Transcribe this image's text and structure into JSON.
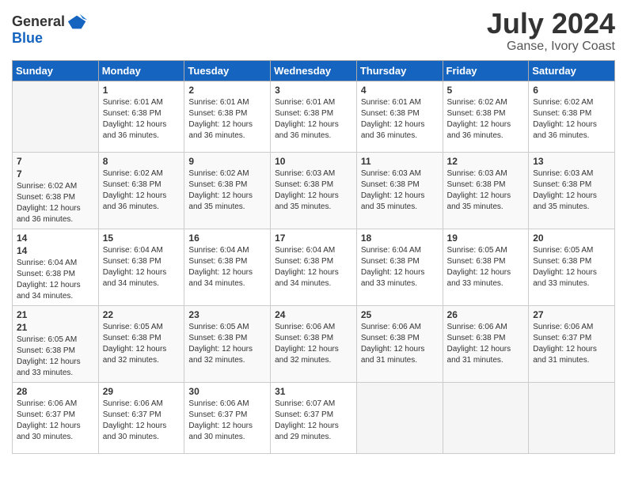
{
  "logo": {
    "line1": "General",
    "line2": "Blue"
  },
  "title": "July 2024",
  "location": "Ganse, Ivory Coast",
  "days_of_week": [
    "Sunday",
    "Monday",
    "Tuesday",
    "Wednesday",
    "Thursday",
    "Friday",
    "Saturday"
  ],
  "weeks": [
    [
      {
        "day": "",
        "info": ""
      },
      {
        "day": "1",
        "info": "Sunrise: 6:01 AM\nSunset: 6:38 PM\nDaylight: 12 hours and 36 minutes."
      },
      {
        "day": "2",
        "info": "Sunrise: 6:01 AM\nSunset: 6:38 PM\nDaylight: 12 hours and 36 minutes."
      },
      {
        "day": "3",
        "info": "Sunrise: 6:01 AM\nSunset: 6:38 PM\nDaylight: 12 hours and 36 minutes."
      },
      {
        "day": "4",
        "info": "Sunrise: 6:01 AM\nSunset: 6:38 PM\nDaylight: 12 hours and 36 minutes."
      },
      {
        "day": "5",
        "info": "Sunrise: 6:02 AM\nSunset: 6:38 PM\nDaylight: 12 hours and 36 minutes."
      },
      {
        "day": "6",
        "info": "Sunrise: 6:02 AM\nSunset: 6:38 PM\nDaylight: 12 hours and 36 minutes."
      }
    ],
    [
      {
        "day": "7",
        "info": ""
      },
      {
        "day": "8",
        "info": "Sunrise: 6:02 AM\nSunset: 6:38 PM\nDaylight: 12 hours and 36 minutes."
      },
      {
        "day": "9",
        "info": "Sunrise: 6:02 AM\nSunset: 6:38 PM\nDaylight: 12 hours and 35 minutes."
      },
      {
        "day": "10",
        "info": "Sunrise: 6:03 AM\nSunset: 6:38 PM\nDaylight: 12 hours and 35 minutes."
      },
      {
        "day": "11",
        "info": "Sunrise: 6:03 AM\nSunset: 6:38 PM\nDaylight: 12 hours and 35 minutes."
      },
      {
        "day": "12",
        "info": "Sunrise: 6:03 AM\nSunset: 6:38 PM\nDaylight: 12 hours and 35 minutes."
      },
      {
        "day": "13",
        "info": "Sunrise: 6:03 AM\nSunset: 6:38 PM\nDaylight: 12 hours and 35 minutes."
      }
    ],
    [
      {
        "day": "14",
        "info": ""
      },
      {
        "day": "15",
        "info": "Sunrise: 6:04 AM\nSunset: 6:38 PM\nDaylight: 12 hours and 34 minutes."
      },
      {
        "day": "16",
        "info": "Sunrise: 6:04 AM\nSunset: 6:38 PM\nDaylight: 12 hours and 34 minutes."
      },
      {
        "day": "17",
        "info": "Sunrise: 6:04 AM\nSunset: 6:38 PM\nDaylight: 12 hours and 34 minutes."
      },
      {
        "day": "18",
        "info": "Sunrise: 6:04 AM\nSunset: 6:38 PM\nDaylight: 12 hours and 33 minutes."
      },
      {
        "day": "19",
        "info": "Sunrise: 6:05 AM\nSunset: 6:38 PM\nDaylight: 12 hours and 33 minutes."
      },
      {
        "day": "20",
        "info": "Sunrise: 6:05 AM\nSunset: 6:38 PM\nDaylight: 12 hours and 33 minutes."
      }
    ],
    [
      {
        "day": "21",
        "info": ""
      },
      {
        "day": "22",
        "info": "Sunrise: 6:05 AM\nSunset: 6:38 PM\nDaylight: 12 hours and 32 minutes."
      },
      {
        "day": "23",
        "info": "Sunrise: 6:05 AM\nSunset: 6:38 PM\nDaylight: 12 hours and 32 minutes."
      },
      {
        "day": "24",
        "info": "Sunrise: 6:06 AM\nSunset: 6:38 PM\nDaylight: 12 hours and 32 minutes."
      },
      {
        "day": "25",
        "info": "Sunrise: 6:06 AM\nSunset: 6:38 PM\nDaylight: 12 hours and 31 minutes."
      },
      {
        "day": "26",
        "info": "Sunrise: 6:06 AM\nSunset: 6:38 PM\nDaylight: 12 hours and 31 minutes."
      },
      {
        "day": "27",
        "info": "Sunrise: 6:06 AM\nSunset: 6:37 PM\nDaylight: 12 hours and 31 minutes."
      }
    ],
    [
      {
        "day": "28",
        "info": "Sunrise: 6:06 AM\nSunset: 6:37 PM\nDaylight: 12 hours and 30 minutes."
      },
      {
        "day": "29",
        "info": "Sunrise: 6:06 AM\nSunset: 6:37 PM\nDaylight: 12 hours and 30 minutes."
      },
      {
        "day": "30",
        "info": "Sunrise: 6:06 AM\nSunset: 6:37 PM\nDaylight: 12 hours and 30 minutes."
      },
      {
        "day": "31",
        "info": "Sunrise: 6:07 AM\nSunset: 6:37 PM\nDaylight: 12 hours and 29 minutes."
      },
      {
        "day": "",
        "info": ""
      },
      {
        "day": "",
        "info": ""
      },
      {
        "day": "",
        "info": ""
      }
    ]
  ],
  "week1_day7_info": "Sunrise: 6:02 AM\nSunset: 6:38 PM\nDaylight: 12 hours and 36 minutes.",
  "week2_day1_info": "Sunrise: 6:02 AM\nSunset: 6:38 PM\nDaylight: 12 hours and 36 minutes.",
  "week3_day1_info": "Sunrise: 6:04 AM\nSunset: 6:38 PM\nDaylight: 12 hours and 34 minutes.",
  "week4_day1_info": "Sunrise: 6:05 AM\nSunset: 6:38 PM\nDaylight: 12 hours and 33 minutes."
}
